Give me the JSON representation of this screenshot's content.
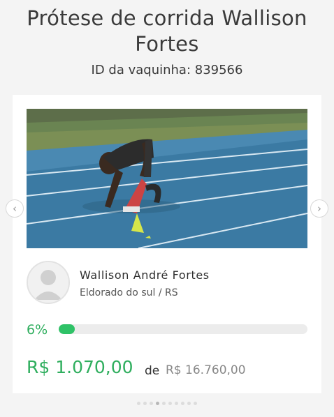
{
  "campaign": {
    "title": "Prótese de corrida Wallison Fortes",
    "id_text": "ID da vaquinha: 839566"
  },
  "photo": {
    "description_icon": "runner-photo"
  },
  "carousel": {
    "prev_icon": "chevron-left-icon",
    "next_icon": "chevron-right-icon",
    "prev_glyph": "‹",
    "next_glyph": "›",
    "dots_total": 10,
    "active_dot": 3
  },
  "owner": {
    "name": "Wallison André Fortes",
    "location": "Eldorado do sul / RS",
    "avatar_icon": "user-avatar-icon"
  },
  "progress": {
    "percent_label": "6%",
    "fraction": 0.06
  },
  "funding": {
    "raised": "R$ 1.070,00",
    "of_label": "de",
    "goal": "R$ 16.760,00"
  },
  "colors": {
    "accent": "#2fae5e",
    "progress_fill": "#2fc267",
    "track_blue": "#3c7ea8"
  }
}
